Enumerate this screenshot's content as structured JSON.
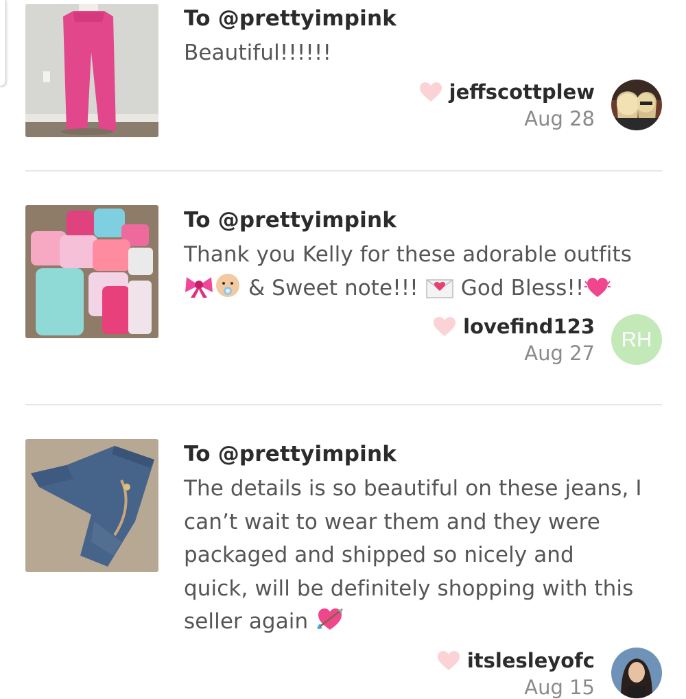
{
  "reviews": [
    {
      "to": "To @prettyimpink",
      "message": "Beautiful!!!!!!",
      "username": "jeffscottplew",
      "date": "Aug 28",
      "thumb_icon": "pink-pants-photo",
      "avatar_icon": "photo-avatar"
    },
    {
      "to": "To @prettyimpink",
      "message_part1": "Thank you Kelly for these adorable outfits",
      "message_part2": " & Sweet note!!! ",
      "message_part3": " God Bless!!",
      "username": "lovefind123",
      "date": "Aug 27",
      "avatar_initials": "RH",
      "avatar_color": "#c3e9b9",
      "thumb_icon": "baby-outfits-photo"
    },
    {
      "to": "To @prettyimpink",
      "message_lines": [
        "The details is so beautiful on these jeans, I",
        "can’t wait to wear them and they were",
        "packaged and shipped so nicely and",
        "quick, will be definitely shopping with this",
        "seller again "
      ],
      "username": "itslesleyofc",
      "date": "Aug 15",
      "thumb_icon": "jeans-photo",
      "avatar_icon": "photo-avatar"
    }
  ],
  "colors": {
    "heart": "#fbd3d6",
    "divider": "#e6e6e6",
    "text_dark": "#2b2b2b",
    "text_muted": "#8a8a8a"
  }
}
